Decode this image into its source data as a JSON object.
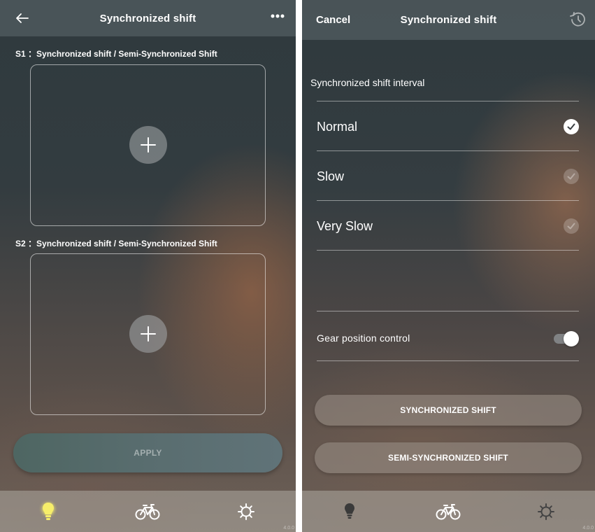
{
  "left_screen": {
    "header": {
      "title": "Synchronized shift"
    },
    "slots": [
      {
        "label": "S1 ：Synchronized shift / Semi-Synchronized Shift"
      },
      {
        "label": "S2 ：Synchronized shift / Semi-Synchronized Shift"
      }
    ],
    "apply_label": "APPLY",
    "nav": {
      "active": "tips",
      "items": [
        "bulb-icon",
        "bicycle-icon",
        "gear-icon"
      ]
    },
    "version": "4.0.0"
  },
  "right_screen": {
    "header": {
      "cancel_label": "Cancel",
      "title": "Synchronized shift"
    },
    "interval_label": "Synchronized shift interval",
    "options": [
      {
        "label": "Normal",
        "selected": true
      },
      {
        "label": "Slow",
        "selected": false
      },
      {
        "label": "Very Slow",
        "selected": false
      }
    ],
    "gear_position_control": {
      "label": "Gear position control",
      "on": true
    },
    "synchronized_button": "SYNCHRONIZED SHIFT",
    "semi_synchronized_button": "SEMI-SYNCHRONIZED SHIFT",
    "nav": {
      "active": "bicycle",
      "items": [
        "bulb-icon",
        "bicycle-icon",
        "gear-icon"
      ]
    },
    "version": "4.0.0"
  },
  "colors": {
    "active_nav": "#f6ee6a",
    "text": "#ffffff"
  }
}
